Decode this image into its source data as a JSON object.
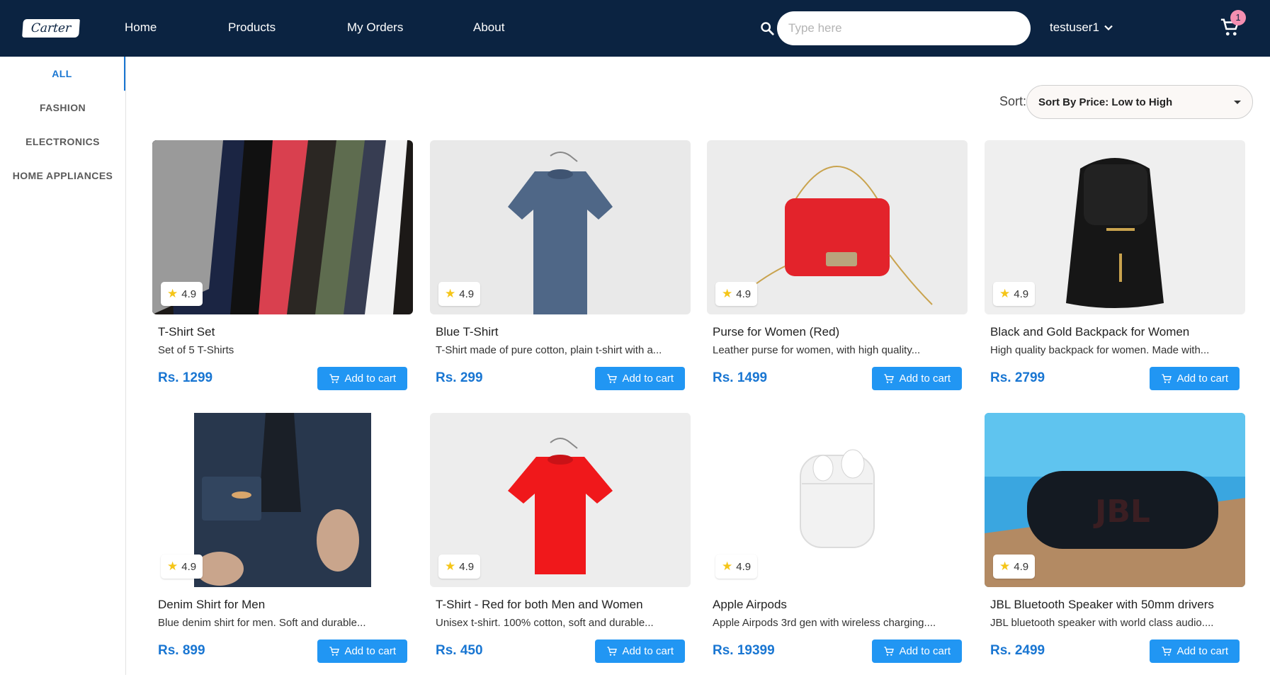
{
  "brand": {
    "logo_text": "Carter"
  },
  "nav": {
    "home": "Home",
    "products": "Products",
    "orders": "My Orders",
    "about": "About"
  },
  "search": {
    "placeholder": "Type here",
    "value": ""
  },
  "user": {
    "name": "testuser1"
  },
  "cart": {
    "count": "1"
  },
  "categories": [
    "ALL",
    "FASHION",
    "ELECTRONICS",
    "HOME APPLIANCES"
  ],
  "active_category": "ALL",
  "sort": {
    "label": "Sort:",
    "selected": "Sort By Price: Low to High"
  },
  "add_to_cart_label": "Add to cart",
  "colors": {
    "header_bg": "#0b2341",
    "accent": "#1976d2",
    "button": "#2196f3",
    "star": "#f5c518",
    "badge": "#f48fb1"
  },
  "products": [
    {
      "name": "T-Shirt Set",
      "desc": "Set of 5 T-Shirts",
      "price": "Rs. 1299",
      "rating": "4.9",
      "image": "stacked-tshirts"
    },
    {
      "name": "Blue T-Shirt",
      "desc": "T-Shirt made of pure cotton, plain t-shirt with a...",
      "price": "Rs. 299",
      "rating": "4.9",
      "image": "blue-tshirt-on-hanger"
    },
    {
      "name": "Purse for Women (Red)",
      "desc": "Leather purse for women, with high quality...",
      "price": "Rs. 1499",
      "rating": "4.9",
      "image": "red-purse"
    },
    {
      "name": "Black and Gold Backpack for Women",
      "desc": "High quality backpack for women. Made with...",
      "price": "Rs. 2799",
      "rating": "4.9",
      "image": "black-backpack"
    },
    {
      "name": "Denim Shirt for Men",
      "desc": "Blue denim shirt for men. Soft and durable...",
      "price": "Rs. 899",
      "rating": "4.9",
      "image": "denim-jacket"
    },
    {
      "name": "T-Shirt - Red for both Men and Women",
      "desc": "Unisex t-shirt. 100% cotton, soft and durable...",
      "price": "Rs. 450",
      "rating": "4.9",
      "image": "red-tshirt-on-hanger"
    },
    {
      "name": "Apple Airpods",
      "desc": "Apple Airpods 3rd gen with wireless charging....",
      "price": "Rs. 19399",
      "rating": "4.9",
      "image": "airpods"
    },
    {
      "name": "JBL Bluetooth Speaker with 50mm drivers",
      "desc": "JBL bluetooth speaker with world class audio....",
      "price": "Rs. 2499",
      "rating": "4.9",
      "image": "jbl-speaker"
    }
  ]
}
